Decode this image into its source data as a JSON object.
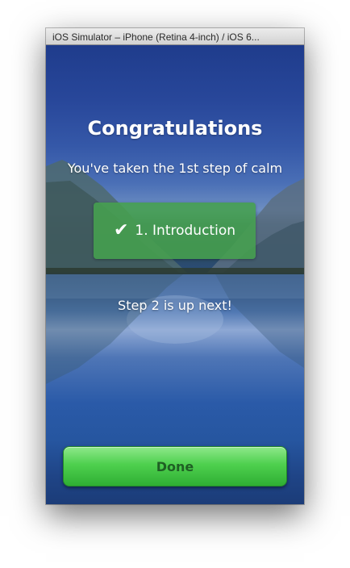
{
  "window": {
    "title": "iOS Simulator – iPhone (Retina 4-inch) / iOS 6..."
  },
  "screen": {
    "heading": "Congratulations",
    "subheading": "You've taken the 1st step of calm",
    "step_card": {
      "icon": "checkmark-icon",
      "label": "1. Introduction"
    },
    "next_text": "Step 2 is up next!",
    "done_label": "Done"
  },
  "colors": {
    "step_card": "#46a04e",
    "done_button": "#4ed04e",
    "done_text": "#1f5f24",
    "text": "#ffffff"
  }
}
